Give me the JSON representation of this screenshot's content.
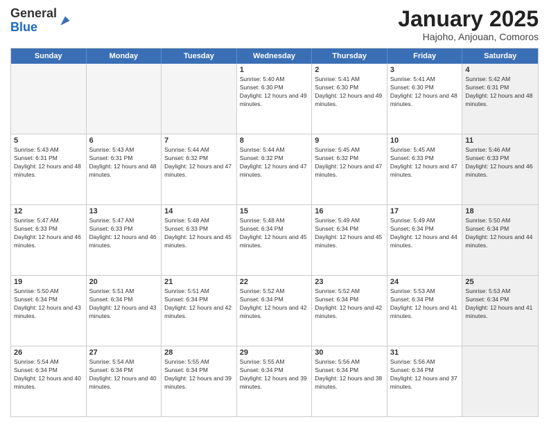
{
  "header": {
    "logo_general": "General",
    "logo_blue": "Blue",
    "month_title": "January 2025",
    "location": "Hajoho, Anjouan, Comoros"
  },
  "weekdays": [
    "Sunday",
    "Monday",
    "Tuesday",
    "Wednesday",
    "Thursday",
    "Friday",
    "Saturday"
  ],
  "weeks": [
    [
      {
        "day": "",
        "empty": true
      },
      {
        "day": "",
        "empty": true
      },
      {
        "day": "",
        "empty": true
      },
      {
        "day": "1",
        "sunrise": "5:40 AM",
        "sunset": "6:30 PM",
        "daylight": "12 hours and 49 minutes."
      },
      {
        "day": "2",
        "sunrise": "5:41 AM",
        "sunset": "6:30 PM",
        "daylight": "12 hours and 49 minutes."
      },
      {
        "day": "3",
        "sunrise": "5:41 AM",
        "sunset": "6:30 PM",
        "daylight": "12 hours and 48 minutes."
      },
      {
        "day": "4",
        "sunrise": "5:42 AM",
        "sunset": "6:31 PM",
        "daylight": "12 hours and 48 minutes.",
        "shaded": true
      }
    ],
    [
      {
        "day": "5",
        "sunrise": "5:43 AM",
        "sunset": "6:31 PM",
        "daylight": "12 hours and 48 minutes."
      },
      {
        "day": "6",
        "sunrise": "5:43 AM",
        "sunset": "6:31 PM",
        "daylight": "12 hours and 48 minutes."
      },
      {
        "day": "7",
        "sunrise": "5:44 AM",
        "sunset": "6:32 PM",
        "daylight": "12 hours and 47 minutes."
      },
      {
        "day": "8",
        "sunrise": "5:44 AM",
        "sunset": "6:32 PM",
        "daylight": "12 hours and 47 minutes."
      },
      {
        "day": "9",
        "sunrise": "5:45 AM",
        "sunset": "6:32 PM",
        "daylight": "12 hours and 47 minutes."
      },
      {
        "day": "10",
        "sunrise": "5:45 AM",
        "sunset": "6:33 PM",
        "daylight": "12 hours and 47 minutes."
      },
      {
        "day": "11",
        "sunrise": "5:46 AM",
        "sunset": "6:33 PM",
        "daylight": "12 hours and 46 minutes.",
        "shaded": true
      }
    ],
    [
      {
        "day": "12",
        "sunrise": "5:47 AM",
        "sunset": "6:33 PM",
        "daylight": "12 hours and 46 minutes."
      },
      {
        "day": "13",
        "sunrise": "5:47 AM",
        "sunset": "6:33 PM",
        "daylight": "12 hours and 46 minutes."
      },
      {
        "day": "14",
        "sunrise": "5:48 AM",
        "sunset": "6:33 PM",
        "daylight": "12 hours and 45 minutes."
      },
      {
        "day": "15",
        "sunrise": "5:48 AM",
        "sunset": "6:34 PM",
        "daylight": "12 hours and 45 minutes."
      },
      {
        "day": "16",
        "sunrise": "5:49 AM",
        "sunset": "6:34 PM",
        "daylight": "12 hours and 45 minutes."
      },
      {
        "day": "17",
        "sunrise": "5:49 AM",
        "sunset": "6:34 PM",
        "daylight": "12 hours and 44 minutes."
      },
      {
        "day": "18",
        "sunrise": "5:50 AM",
        "sunset": "6:34 PM",
        "daylight": "12 hours and 44 minutes.",
        "shaded": true
      }
    ],
    [
      {
        "day": "19",
        "sunrise": "5:50 AM",
        "sunset": "6:34 PM",
        "daylight": "12 hours and 43 minutes."
      },
      {
        "day": "20",
        "sunrise": "5:51 AM",
        "sunset": "6:34 PM",
        "daylight": "12 hours and 43 minutes."
      },
      {
        "day": "21",
        "sunrise": "5:51 AM",
        "sunset": "6:34 PM",
        "daylight": "12 hours and 42 minutes."
      },
      {
        "day": "22",
        "sunrise": "5:52 AM",
        "sunset": "6:34 PM",
        "daylight": "12 hours and 42 minutes."
      },
      {
        "day": "23",
        "sunrise": "5:52 AM",
        "sunset": "6:34 PM",
        "daylight": "12 hours and 42 minutes."
      },
      {
        "day": "24",
        "sunrise": "5:53 AM",
        "sunset": "6:34 PM",
        "daylight": "12 hours and 41 minutes."
      },
      {
        "day": "25",
        "sunrise": "5:53 AM",
        "sunset": "6:34 PM",
        "daylight": "12 hours and 41 minutes.",
        "shaded": true
      }
    ],
    [
      {
        "day": "26",
        "sunrise": "5:54 AM",
        "sunset": "6:34 PM",
        "daylight": "12 hours and 40 minutes."
      },
      {
        "day": "27",
        "sunrise": "5:54 AM",
        "sunset": "6:34 PM",
        "daylight": "12 hours and 40 minutes."
      },
      {
        "day": "28",
        "sunrise": "5:55 AM",
        "sunset": "6:34 PM",
        "daylight": "12 hours and 39 minutes."
      },
      {
        "day": "29",
        "sunrise": "5:55 AM",
        "sunset": "6:34 PM",
        "daylight": "12 hours and 39 minutes."
      },
      {
        "day": "30",
        "sunrise": "5:56 AM",
        "sunset": "6:34 PM",
        "daylight": "12 hours and 38 minutes."
      },
      {
        "day": "31",
        "sunrise": "5:56 AM",
        "sunset": "6:34 PM",
        "daylight": "12 hours and 37 minutes."
      },
      {
        "day": "",
        "empty": true,
        "shaded": true
      }
    ]
  ]
}
